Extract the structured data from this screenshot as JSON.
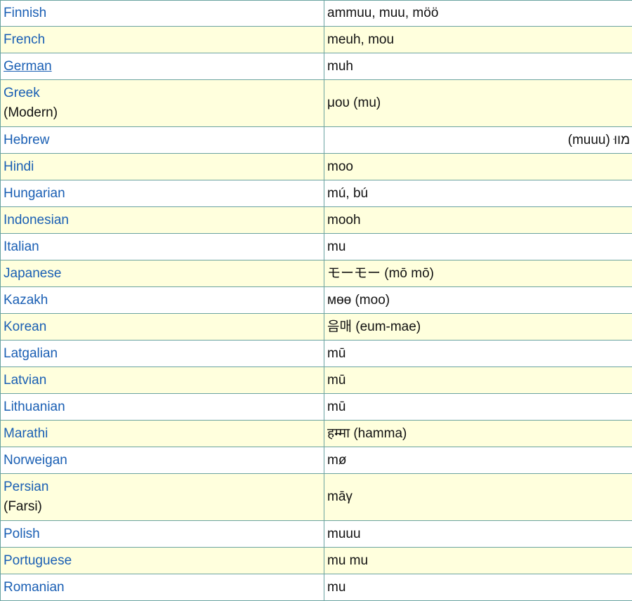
{
  "rows": [
    {
      "language": "Finnish",
      "note": "",
      "sound": "ammuu, muu, möö",
      "rtl": false,
      "underlined": false
    },
    {
      "language": "French",
      "note": "",
      "sound": "meuh, mou",
      "rtl": false,
      "underlined": false
    },
    {
      "language": "German",
      "note": "",
      "sound": "muh",
      "rtl": false,
      "underlined": true
    },
    {
      "language": "Greek",
      "note": "(Modern)",
      "sound": "μου (mu)",
      "rtl": false,
      "underlined": false
    },
    {
      "language": "Hebrew",
      "note": "",
      "sound": "מווּ (muuu)",
      "rtl": true,
      "underlined": false
    },
    {
      "language": "Hindi",
      "note": "",
      "sound": "moo",
      "rtl": false,
      "underlined": false
    },
    {
      "language": "Hungarian",
      "note": "",
      "sound": "mú, bú",
      "rtl": false,
      "underlined": false
    },
    {
      "language": "Indonesian",
      "note": "",
      "sound": "mooh",
      "rtl": false,
      "underlined": false
    },
    {
      "language": "Italian",
      "note": "",
      "sound": "mu",
      "rtl": false,
      "underlined": false
    },
    {
      "language": "Japanese",
      "note": "",
      "sound": "モーモー (mō mō)",
      "rtl": false,
      "underlined": false
    },
    {
      "language": "Kazakh",
      "note": "",
      "sound": "мөө (moo)",
      "rtl": false,
      "underlined": false
    },
    {
      "language": "Korean",
      "note": "",
      "sound": "음매 (eum-mae)",
      "rtl": false,
      "underlined": false
    },
    {
      "language": "Latgalian",
      "note": "",
      "sound": "mū",
      "rtl": false,
      "underlined": false
    },
    {
      "language": "Latvian",
      "note": "",
      "sound": "mū",
      "rtl": false,
      "underlined": false
    },
    {
      "language": "Lithuanian",
      "note": "",
      "sound": "mū",
      "rtl": false,
      "underlined": false
    },
    {
      "language": "Marathi",
      "note": "",
      "sound": "हम्मा (hamma)",
      "rtl": false,
      "underlined": false
    },
    {
      "language": "Norweigan",
      "note": "",
      "sound": "mø",
      "rtl": false,
      "underlined": false
    },
    {
      "language": "Persian",
      "note": "(Farsi)",
      "sound": "māγ",
      "rtl": false,
      "underlined": false
    },
    {
      "language": "Polish",
      "note": "",
      "sound": "muuu",
      "rtl": false,
      "underlined": false
    },
    {
      "language": "Portuguese",
      "note": "",
      "sound": "mu mu",
      "rtl": false,
      "underlined": false
    },
    {
      "language": "Romanian",
      "note": "",
      "sound": "mu",
      "rtl": false,
      "underlined": false
    }
  ],
  "colors": {
    "link": "#1a5fb4",
    "row_even": "#ffffdd",
    "row_odd": "#ffffff",
    "border": "#6aa3a0"
  }
}
